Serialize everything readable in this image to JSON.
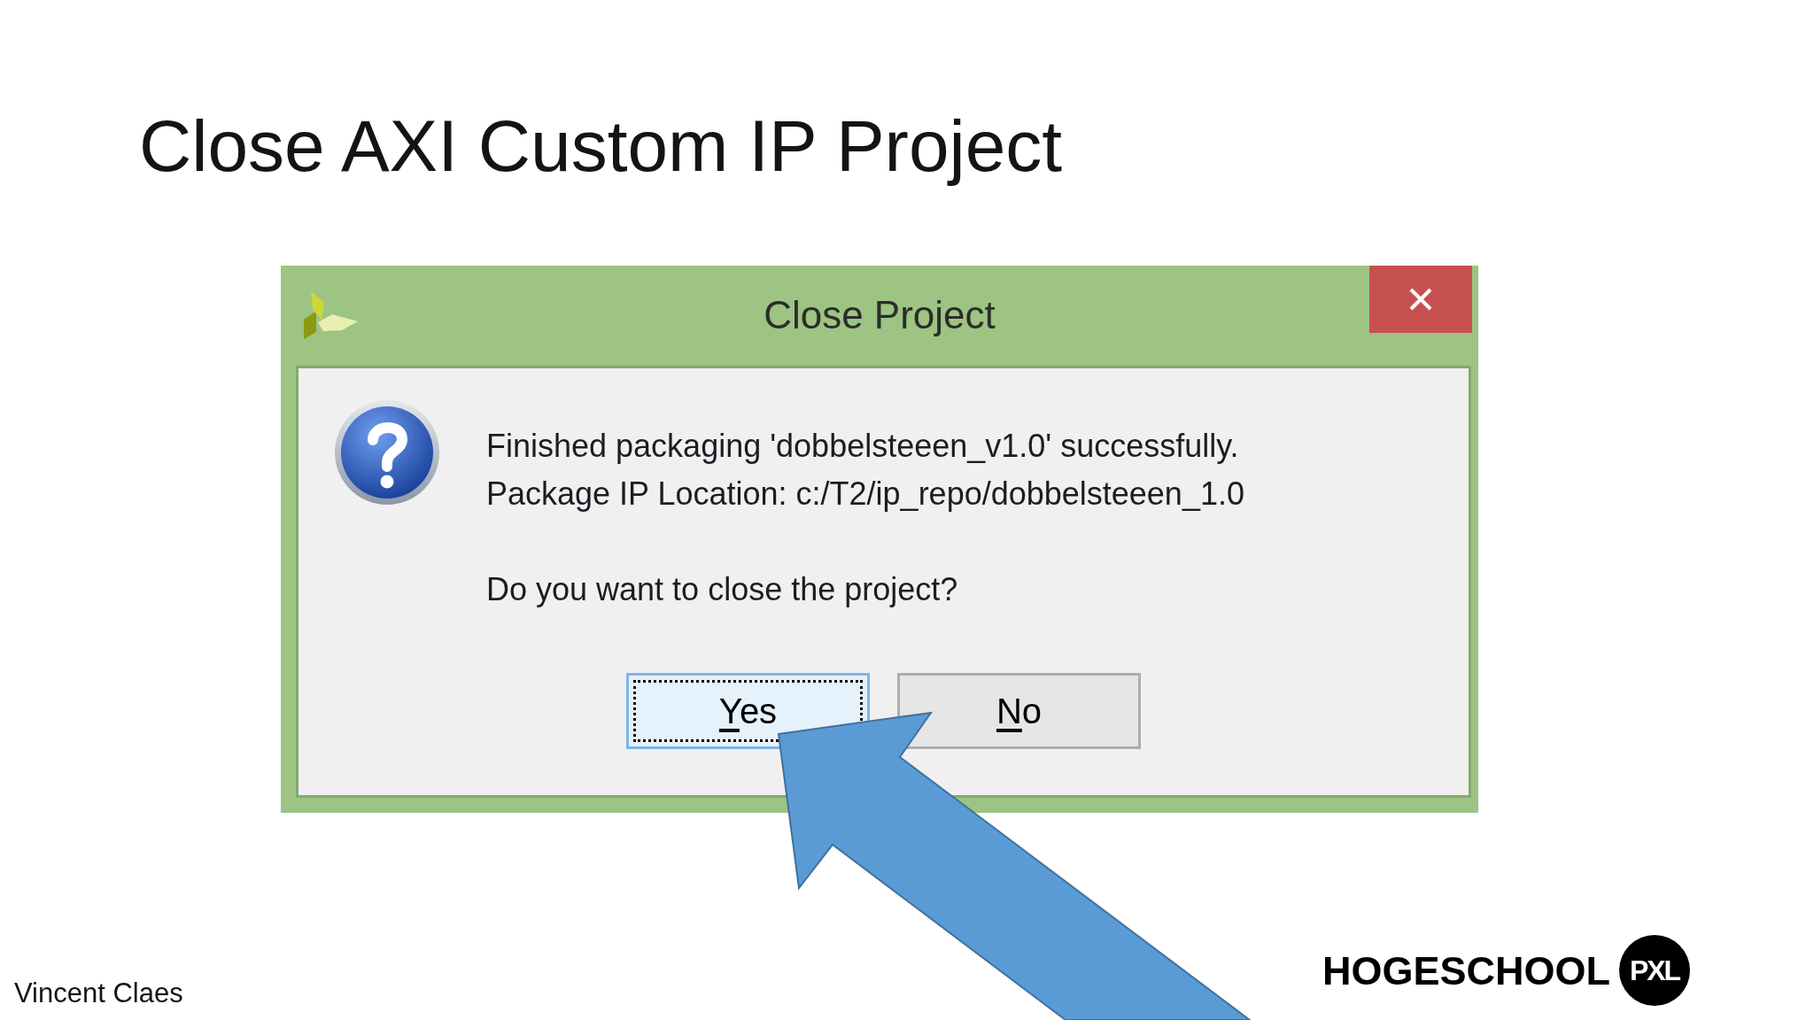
{
  "slide": {
    "title": "Close AXI Custom IP Project"
  },
  "dialog": {
    "title": "Close Project",
    "message_lines": [
      "Finished packaging 'dobbelsteeen_v1.0' successfully.",
      "Package IP Location: c:/T2/ip_repo/dobbelsteeen_1.0"
    ],
    "question": "Do you want to close the project?",
    "buttons": [
      {
        "label": "Yes",
        "focused": true
      },
      {
        "label": "No",
        "focused": false
      }
    ]
  },
  "footer": {
    "author": "Vincent Claes",
    "logo": {
      "wordmark": "HOGESCHOOL",
      "badge": "PXL"
    }
  }
}
